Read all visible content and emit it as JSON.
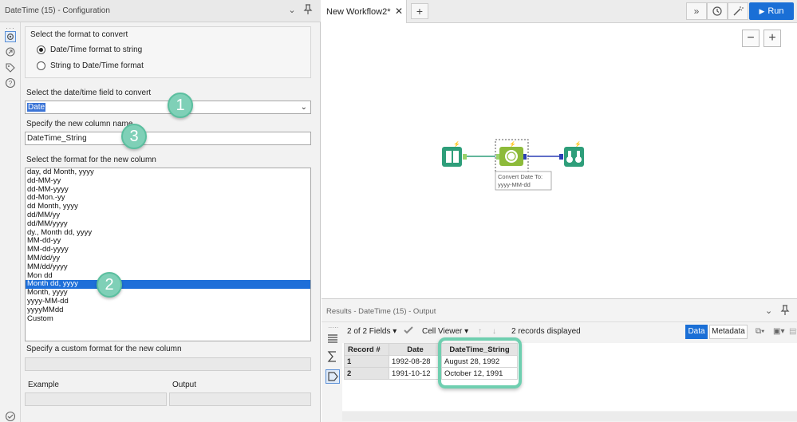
{
  "config": {
    "title": "DateTime (15) - Configuration",
    "format_group_label": "Select the format to convert",
    "radio_datetime_to_string": "Date/Time format to string",
    "radio_string_to_datetime": "String to Date/Time format",
    "field_label": "Select the date/time field to convert",
    "field_value": "Date",
    "column_name_label": "Specify the new column name",
    "column_name_value": "DateTime_String",
    "format_list_label": "Select the format for the new column",
    "formats": [
      "day, dd Month, yyyy",
      "dd-MM-yy",
      "dd-MM-yyyy",
      "dd-Mon.-yy",
      "dd Month, yyyy",
      "dd/MM/yy",
      "dd/MM/yyyy",
      "dy., Month dd, yyyy",
      "MM-dd-yy",
      "MM-dd-yyyy",
      "MM/dd/yy",
      "MM/dd/yyyy",
      "Mon dd",
      "Month dd, yyyy",
      "Month, yyyy",
      "yyyy-MM-dd",
      "yyyyMMdd",
      "Custom"
    ],
    "selected_format": "Month dd, yyyy",
    "custom_format_label": "Specify a custom format for the new column",
    "example_label": "Example",
    "output_label": "Output"
  },
  "callouts": [
    "1",
    "2",
    "3"
  ],
  "workflow": {
    "tab_label": "New Workflow2*",
    "tab_close": "✕",
    "tab_add": "+",
    "run_label": "Run",
    "zoom_out": "−",
    "zoom_in": "+",
    "tool_annotation_line1": "Convert Date To:",
    "tool_annotation_line2": "yyyy-MM-dd"
  },
  "results": {
    "title": "Results - DateTime (15) - Output",
    "fields_label": "2 of 2 Fields",
    "cell_viewer_label": "Cell Viewer",
    "records_label": "2 records displayed",
    "data_tab": "Data",
    "metadata_tab": "Metadata",
    "columns": [
      "Record #",
      "Date",
      "DateTime_String"
    ],
    "rows": [
      [
        "1",
        "1992-08-28",
        "August 28, 1992"
      ],
      [
        "2",
        "1991-10-12",
        "October 12, 1991"
      ]
    ]
  },
  "colors": {
    "accent": "#1a6fd6",
    "callout": "#7fd0b7",
    "tool_green": "#2e9e7a",
    "tool_lime": "#8dbb3a"
  }
}
